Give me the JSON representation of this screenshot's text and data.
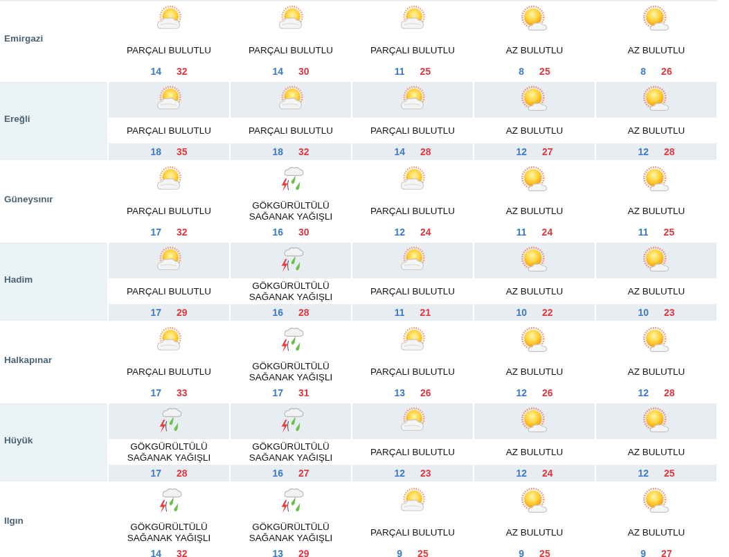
{
  "locations": [
    {
      "name": "Emirgazi",
      "days": [
        {
          "kind": "partly",
          "condition": "PARÇALI BULUTLU",
          "low": "14",
          "high": "32"
        },
        {
          "kind": "partly",
          "condition": "PARÇALI BULUTLU",
          "low": "14",
          "high": "30"
        },
        {
          "kind": "partly",
          "condition": "PARÇALI BULUTLU",
          "low": "11",
          "high": "25"
        },
        {
          "kind": "few",
          "condition": "AZ BULUTLU",
          "low": "8",
          "high": "25"
        },
        {
          "kind": "few",
          "condition": "AZ BULUTLU",
          "low": "8",
          "high": "26"
        }
      ]
    },
    {
      "name": "Ereğli",
      "days": [
        {
          "kind": "partly",
          "condition": "PARÇALI BULUTLU",
          "low": "18",
          "high": "35"
        },
        {
          "kind": "partly",
          "condition": "PARÇALI BULUTLU",
          "low": "18",
          "high": "32"
        },
        {
          "kind": "partly",
          "condition": "PARÇALI BULUTLU",
          "low": "14",
          "high": "28"
        },
        {
          "kind": "few",
          "condition": "AZ BULUTLU",
          "low": "12",
          "high": "27"
        },
        {
          "kind": "few",
          "condition": "AZ BULUTLU",
          "low": "12",
          "high": "28"
        }
      ]
    },
    {
      "name": "Güneysınır",
      "days": [
        {
          "kind": "partly",
          "condition": "PARÇALI BULUTLU",
          "low": "17",
          "high": "32"
        },
        {
          "kind": "storm",
          "condition": "GÖKGÜRÜLTÜLÜ SAĞANAK YAĞIŞLI",
          "low": "16",
          "high": "30"
        },
        {
          "kind": "partly",
          "condition": "PARÇALI BULUTLU",
          "low": "12",
          "high": "24"
        },
        {
          "kind": "few",
          "condition": "AZ BULUTLU",
          "low": "11",
          "high": "24"
        },
        {
          "kind": "few",
          "condition": "AZ BULUTLU",
          "low": "11",
          "high": "25"
        }
      ]
    },
    {
      "name": "Hadim",
      "days": [
        {
          "kind": "partly",
          "condition": "PARÇALI BULUTLU",
          "low": "17",
          "high": "29"
        },
        {
          "kind": "storm",
          "condition": "GÖKGÜRÜLTÜLÜ SAĞANAK YAĞIŞLI",
          "low": "16",
          "high": "28"
        },
        {
          "kind": "partly",
          "condition": "PARÇALI BULUTLU",
          "low": "11",
          "high": "21"
        },
        {
          "kind": "few",
          "condition": "AZ BULUTLU",
          "low": "10",
          "high": "22"
        },
        {
          "kind": "few",
          "condition": "AZ BULUTLU",
          "low": "10",
          "high": "23"
        }
      ]
    },
    {
      "name": "Halkapınar",
      "days": [
        {
          "kind": "partly",
          "condition": "PARÇALI BULUTLU",
          "low": "17",
          "high": "33"
        },
        {
          "kind": "storm",
          "condition": "GÖKGÜRÜLTÜLÜ SAĞANAK YAĞIŞLI",
          "low": "17",
          "high": "31"
        },
        {
          "kind": "partly",
          "condition": "PARÇALI BULUTLU",
          "low": "13",
          "high": "26"
        },
        {
          "kind": "few",
          "condition": "AZ BULUTLU",
          "low": "12",
          "high": "26"
        },
        {
          "kind": "few",
          "condition": "AZ BULUTLU",
          "low": "12",
          "high": "28"
        }
      ]
    },
    {
      "name": "Hüyük",
      "days": [
        {
          "kind": "storm",
          "condition": "GÖKGÜRÜLTÜLÜ SAĞANAK YAĞIŞLI",
          "low": "17",
          "high": "28"
        },
        {
          "kind": "storm",
          "condition": "GÖKGÜRÜLTÜLÜ SAĞANAK YAĞIŞLI",
          "low": "16",
          "high": "27"
        },
        {
          "kind": "partly",
          "condition": "PARÇALI BULUTLU",
          "low": "12",
          "high": "23"
        },
        {
          "kind": "few",
          "condition": "AZ BULUTLU",
          "low": "12",
          "high": "24"
        },
        {
          "kind": "few",
          "condition": "AZ BULUTLU",
          "low": "12",
          "high": "25"
        }
      ]
    },
    {
      "name": "Ilgın",
      "days": [
        {
          "kind": "storm",
          "condition": "GÖKGÜRÜLTÜLÜ SAĞANAK YAĞIŞLI",
          "low": "14",
          "high": "32"
        },
        {
          "kind": "storm",
          "condition": "GÖKGÜRÜLTÜLÜ SAĞANAK YAĞIŞLI",
          "low": "13",
          "high": "29"
        },
        {
          "kind": "partly",
          "condition": "PARÇALI BULUTLU",
          "low": "9",
          "high": "25"
        },
        {
          "kind": "few",
          "condition": "AZ BULUTLU",
          "low": "9",
          "high": "25"
        },
        {
          "kind": "few",
          "condition": "AZ BULUTLU",
          "low": "9",
          "high": "27"
        }
      ]
    }
  ]
}
